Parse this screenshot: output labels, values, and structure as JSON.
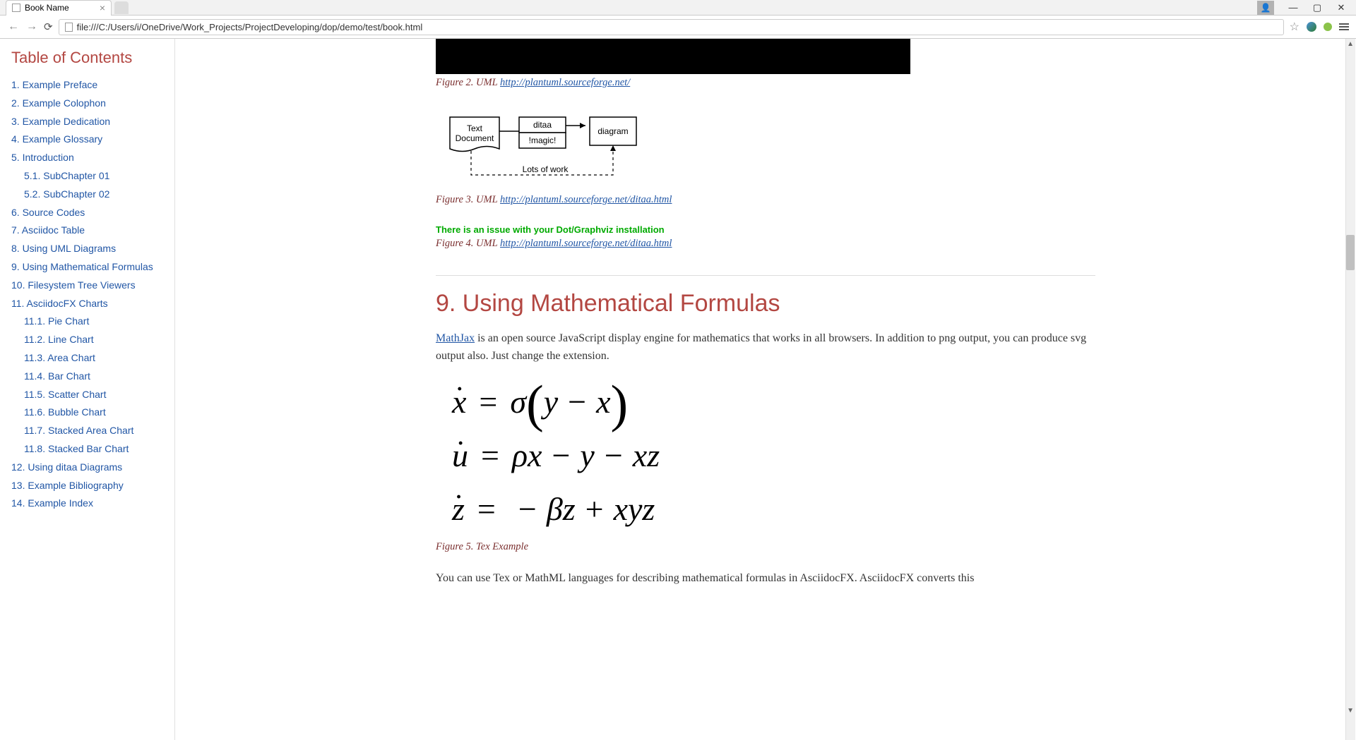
{
  "browser": {
    "tab_title": "Book Name",
    "url": "file:///C:/Users/i/OneDrive/Work_Projects/ProjectDeveloping/dop/demo/test/book.html"
  },
  "toc": {
    "title": "Table of Contents",
    "items": [
      {
        "label": "1. Example Preface"
      },
      {
        "label": "2. Example Colophon"
      },
      {
        "label": "3. Example Dedication"
      },
      {
        "label": "4. Example Glossary"
      },
      {
        "label": "5. Introduction",
        "children": [
          {
            "label": "5.1. SubChapter 01"
          },
          {
            "label": "5.2. SubChapter 02"
          }
        ]
      },
      {
        "label": "6. Source Codes"
      },
      {
        "label": "7. Asciidoc Table"
      },
      {
        "label": "8. Using UML Diagrams"
      },
      {
        "label": "9. Using Mathematical Formulas"
      },
      {
        "label": "10. Filesystem Tree Viewers"
      },
      {
        "label": "11. AsciidocFX Charts",
        "children": [
          {
            "label": "11.1. Pie Chart"
          },
          {
            "label": "11.2. Line Chart"
          },
          {
            "label": "11.3. Area Chart"
          },
          {
            "label": "11.4. Bar Chart"
          },
          {
            "label": "11.5. Scatter Chart"
          },
          {
            "label": "11.6. Bubble Chart"
          },
          {
            "label": "11.7. Stacked Area Chart"
          },
          {
            "label": "11.8. Stacked Bar Chart"
          }
        ]
      },
      {
        "label": "12. Using ditaa Diagrams"
      },
      {
        "label": "13. Example Bibliography"
      },
      {
        "label": "14. Example Index"
      }
    ]
  },
  "figures": {
    "fig2": {
      "prefix": "Figure 2. UML ",
      "link": "http://plantuml.sourceforge.net/"
    },
    "fig3": {
      "prefix": "Figure 3. UML ",
      "link": "http://plantuml.sourceforge.net/ditaa.html"
    },
    "fig4": {
      "prefix": "Figure 4. UML ",
      "link": "http://plantuml.sourceforge.net/ditaa.html"
    },
    "fig5": {
      "label": "Figure 5. Tex Example"
    }
  },
  "ditaa": {
    "box1_line1": "Text",
    "box1_line2": "Document",
    "box2_top": "ditaa",
    "box2_bottom": "!magic!",
    "box3": "diagram",
    "bottom_label": "Lots of work"
  },
  "warning": "There is an issue with your Dot/Graphviz installation",
  "section9": {
    "heading": "9. Using Mathematical Formulas",
    "mathjax_link": "MathJax",
    "para1": " is an open source JavaScript display engine for mathematics that works in all browsers. In addition to png output, you can produce svg output also. Just change the extension.",
    "para2": "You can use Tex or MathML languages for describing mathematical formulas in AsciidocFX. AsciidocFX converts this"
  },
  "math": {
    "eq1": {
      "lhs": "ẋ",
      "rhs": "σ(y − x)"
    },
    "eq2": {
      "lhs": "u̇",
      "rhs": "ρx − y − xz"
    },
    "eq3": {
      "lhs": "ż",
      "rhs": "−βz + xyz"
    }
  }
}
